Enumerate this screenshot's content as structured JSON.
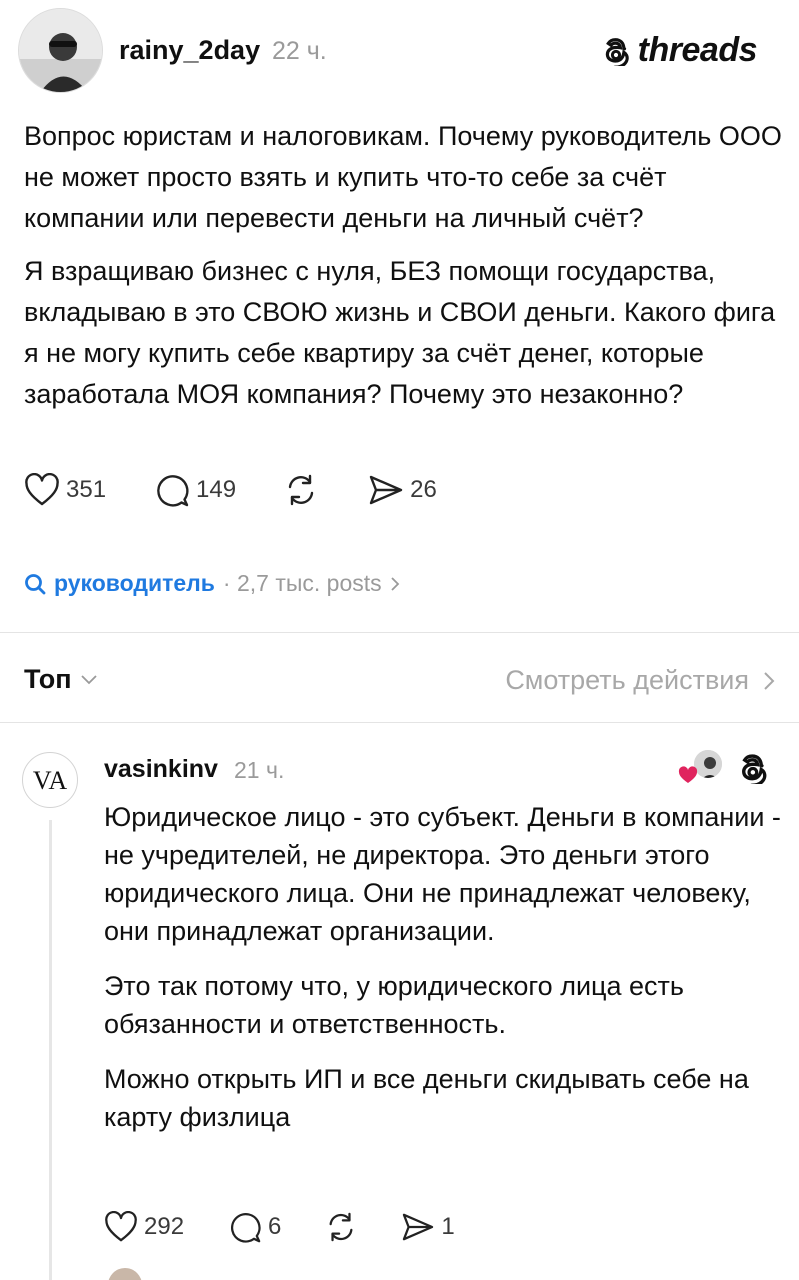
{
  "post": {
    "username": "rainy_2day",
    "timestamp": "22 ч.",
    "brand": "threads",
    "paragraphs": [
      "Вопрос юристам и налоговикам. Почему руководитель ООО не может просто взять и купить что-то себе за счёт компании или перевести деньги на личный счёт?",
      "Я взращиваю бизнес с нуля, БЕЗ помощи государства, вкладываю в это СВОЮ жизнь и СВОИ деньги. Какого фига я не могу купить себе квартиру за счёт денег, которые заработала МОЯ компания? Почему это незаконно?"
    ],
    "actions": {
      "likes": "351",
      "replies": "149",
      "shares": "26"
    }
  },
  "topic": {
    "tag": "руководитель",
    "meta": "· 2,7 тыс. posts"
  },
  "sort": {
    "label": "Топ",
    "view_activity": "Смотреть действия"
  },
  "reply": {
    "username": "vasinkinv",
    "timestamp": "21 ч.",
    "avatar_text": "VA",
    "paragraphs": [
      "Юридическое лицо - это субъект. Деньги в компании - не учредителей, не директора. Это деньги этого юридического лица. Они не принадлежат человеку, они принадлежат организации.",
      "Это так потому что, у юридического лица есть обязанности и ответственность.",
      "Можно открыть ИП и все деньги скидывать себе на карту физлица"
    ],
    "actions": {
      "likes": "292",
      "replies": "6",
      "shares": "1"
    }
  },
  "icons": {
    "like": "heart-icon",
    "reply": "comment-icon",
    "repost": "repost-icon",
    "share": "send-icon",
    "search": "search-icon",
    "chevron": "chevron-icon"
  },
  "colors": {
    "text": "#101010",
    "muted": "#9a9a9a",
    "link": "#1f7ae0",
    "like_heart": "#e0245e"
  }
}
